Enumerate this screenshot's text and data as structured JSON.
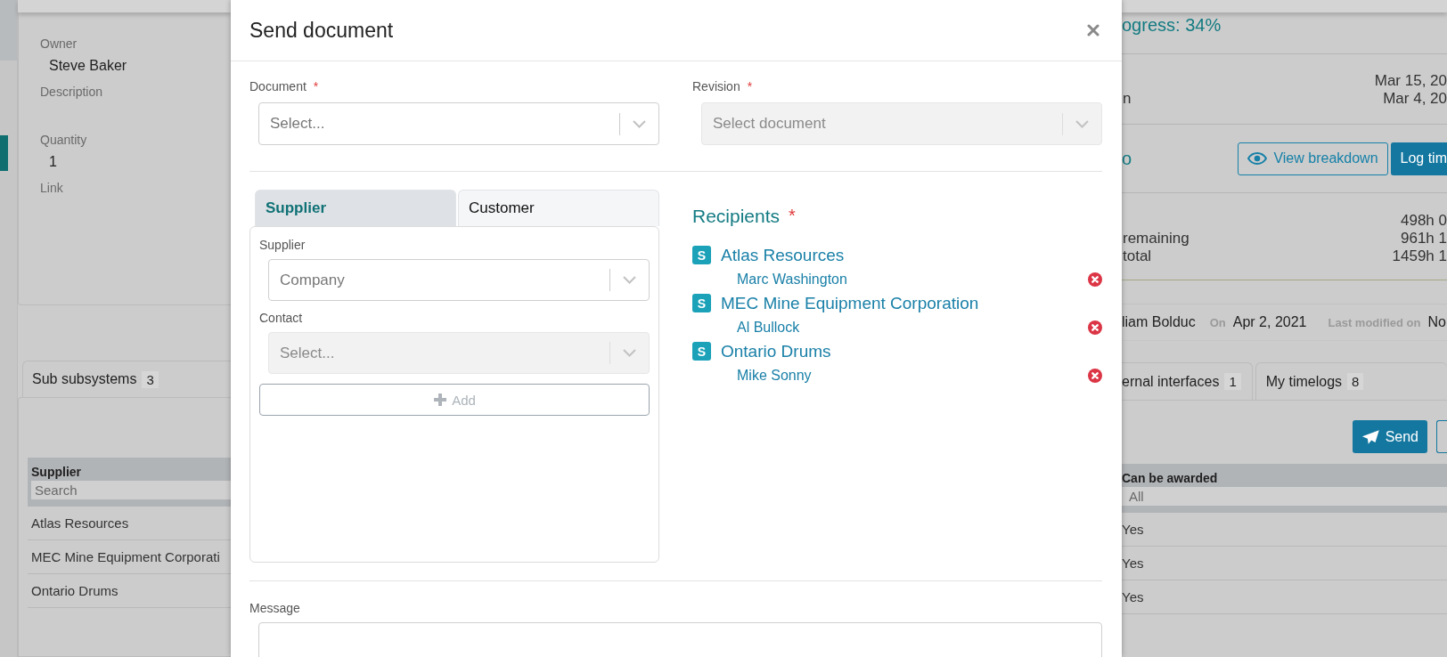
{
  "background_left": {
    "fields": [
      {
        "label": "Owner",
        "value": "Steve Baker"
      },
      {
        "label": "Description"
      },
      {
        "label": "Quantity",
        "value": "1"
      },
      {
        "label": "Link"
      }
    ],
    "tab": {
      "label": "Sub subsystems",
      "count": "3"
    },
    "table": {
      "column": "Supplier",
      "filter_placeholder": "Search",
      "rows": [
        "Atlas Resources",
        "MEC Mine Equipment Corporati",
        "Ontario Drums"
      ]
    }
  },
  "background_right": {
    "progress": "ogress: 34%",
    "dates": [
      {
        "value": "Mar 15, 20"
      },
      {
        "label": "n",
        "value": "Mar 4, 20"
      }
    ],
    "section_fragment": "o",
    "buttons": [
      {
        "label": "View breakdown",
        "kind": "outline"
      },
      {
        "label": "Log tim",
        "kind": "primary"
      }
    ],
    "hours": [
      {
        "value": "498h 0"
      },
      {
        "label": "remaining",
        "value": "961h 1"
      },
      {
        "label": "total",
        "value": "1459h 1"
      }
    ],
    "created_by": "liam Bolduc",
    "on_label": "On",
    "created_on": "Apr 2, 2021",
    "modified_label": "Last modified on",
    "modified_on": "No",
    "tabs": [
      {
        "label": "ernal interfaces",
        "count": "1"
      },
      {
        "label": "My timelogs",
        "count": "8"
      }
    ],
    "send_button": "Send",
    "table": {
      "column": "Can be awarded",
      "filter_value": "All",
      "rows": [
        "Yes",
        "Yes",
        "Yes"
      ]
    }
  },
  "modal": {
    "title": "Send document",
    "document": {
      "label": "Document",
      "required_mark": "*",
      "placeholder": "Select...",
      "disabled": false
    },
    "revision": {
      "label": "Revision",
      "required_mark": "*",
      "placeholder": "Select document",
      "disabled": true
    },
    "tabs": [
      {
        "label": "Supplier",
        "selected": true
      },
      {
        "label": "Customer",
        "selected": false
      }
    ],
    "supplier_field": {
      "label": "Supplier",
      "placeholder": "Company",
      "disabled": false
    },
    "contact_field": {
      "label": "Contact",
      "placeholder": "Select...",
      "disabled": true
    },
    "add_button": {
      "label": "Add",
      "disabled": true
    },
    "recipients": {
      "title": "Recipients",
      "required_mark": "*",
      "groups": [
        {
          "badge": "S",
          "company": "Atlas Resources",
          "contacts": [
            "Marc Washington"
          ]
        },
        {
          "badge": "S",
          "company": "MEC Mine Equipment Corporation",
          "contacts": [
            "Al Bullock"
          ]
        },
        {
          "badge": "S",
          "company": "Ontario Drums",
          "contacts": [
            "Mike Sonny"
          ]
        }
      ]
    },
    "message": {
      "label": "Message"
    }
  }
}
